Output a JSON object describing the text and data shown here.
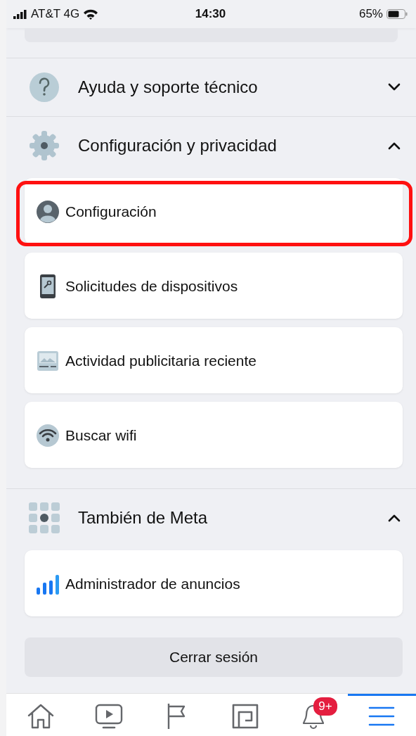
{
  "status_bar": {
    "carrier": "AT&T 4G",
    "time": "14:30",
    "battery": "65%"
  },
  "sections": [
    {
      "title": "Ayuda y soporte técnico",
      "kind": "help",
      "expanded": false
    },
    {
      "title": "Configuración y privacidad",
      "kind": "gear",
      "expanded": true,
      "items": [
        {
          "label": "Configuración",
          "kind": "person",
          "highlighted": true
        },
        {
          "label": "Solicitudes de dispositivos",
          "kind": "phone",
          "highlighted": false
        },
        {
          "label": "Actividad publicitaria reciente",
          "kind": "ad",
          "highlighted": false
        },
        {
          "label": "Buscar wifi",
          "kind": "wifi",
          "highlighted": false
        }
      ]
    },
    {
      "title": "También de Meta",
      "kind": "grid",
      "expanded": true,
      "items": [
        {
          "label": "Administrador de anuncios",
          "kind": "bars",
          "highlighted": false
        }
      ]
    }
  ],
  "logout": "Cerrar sesión",
  "tabs": [
    {
      "kind": "home",
      "selected": false
    },
    {
      "kind": "video",
      "selected": false
    },
    {
      "kind": "flag",
      "selected": false
    },
    {
      "kind": "gaming",
      "selected": false
    },
    {
      "kind": "bell",
      "selected": false,
      "badge": "9+"
    },
    {
      "kind": "menu",
      "selected": true
    }
  ]
}
